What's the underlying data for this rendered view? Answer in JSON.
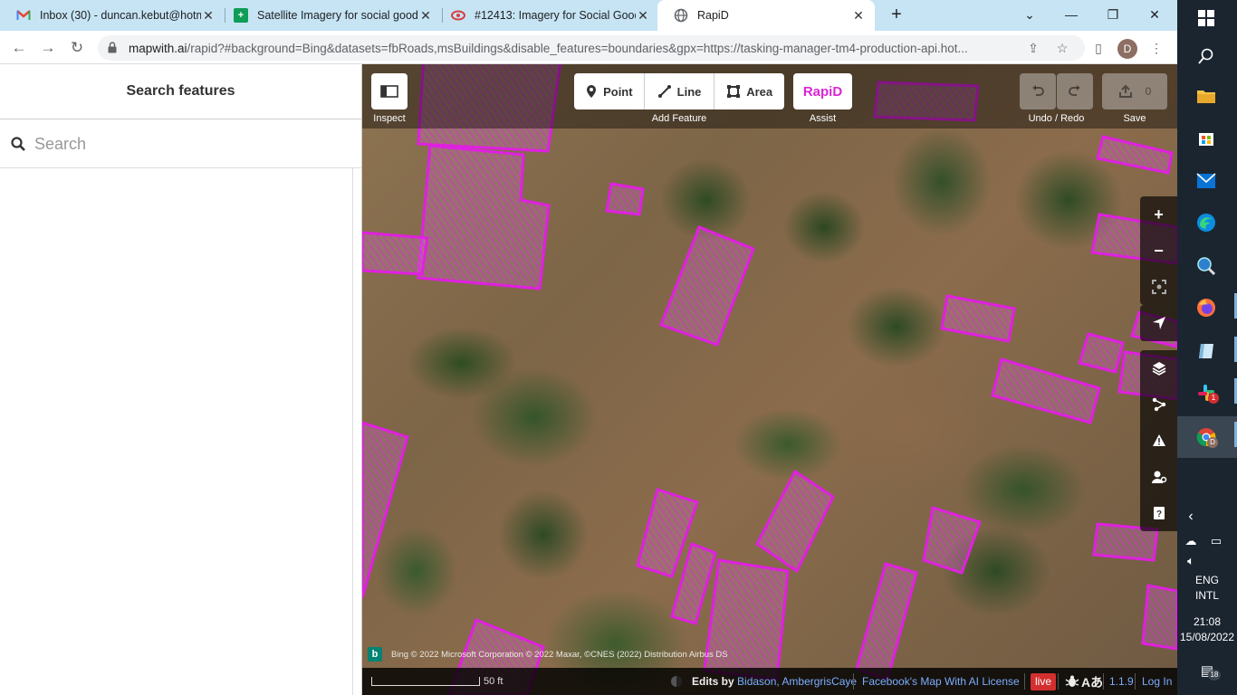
{
  "browser": {
    "tabs": [
      {
        "title": "Inbox (30) - duncan.kebut@hotm",
        "icon": "gmail-icon"
      },
      {
        "title": "Satellite Imagery for social good",
        "icon": "sheets-icon"
      },
      {
        "title": "#12413: Imagery for Social Good",
        "icon": "tasking-manager-icon"
      },
      {
        "title": "RapiD",
        "icon": "globe-icon"
      }
    ],
    "url_host": "mapwith.ai",
    "url_path": "/rapid?#background=Bing&datasets=fbRoads,msBuildings&disable_features=boundaries&gpx=https://tasking-manager-tm4-production-api.hot...",
    "profile_initial": "D"
  },
  "sidebar": {
    "title": "Search features",
    "search_placeholder": "Search"
  },
  "map": {
    "inspect_label": "Inspect",
    "modes": [
      {
        "label": "Point",
        "icon": "point-icon"
      },
      {
        "label": "Line",
        "icon": "line-icon"
      },
      {
        "label": "Area",
        "icon": "area-icon"
      }
    ],
    "add_feature_label": "Add Feature",
    "rapid_button": {
      "label": "RapiD",
      "caption": "Assist"
    },
    "undo_redo_label": "Undo / Redo",
    "save": {
      "label": "Save",
      "count": "0"
    },
    "attribution": "Bing © 2022 Microsoft Corporation © 2022 Maxar, ©CNES (2022) Distribution Airbus DS",
    "scale_label": "50 ft",
    "edits_prefix": "Edits by",
    "editors": "Bidason, AmbergrisCaye",
    "license_link": "Facebook's Map With AI License",
    "live_label": "live",
    "version": "1.1.9",
    "login_label": "Log In",
    "building_color": "#e020e0"
  },
  "taskbar": {
    "language": "ENG",
    "layout": "INTL",
    "time": "21:08",
    "date": "15/08/2022",
    "notification_count": "18",
    "slack_badge": "1",
    "chrome_profile_badge": "D"
  }
}
